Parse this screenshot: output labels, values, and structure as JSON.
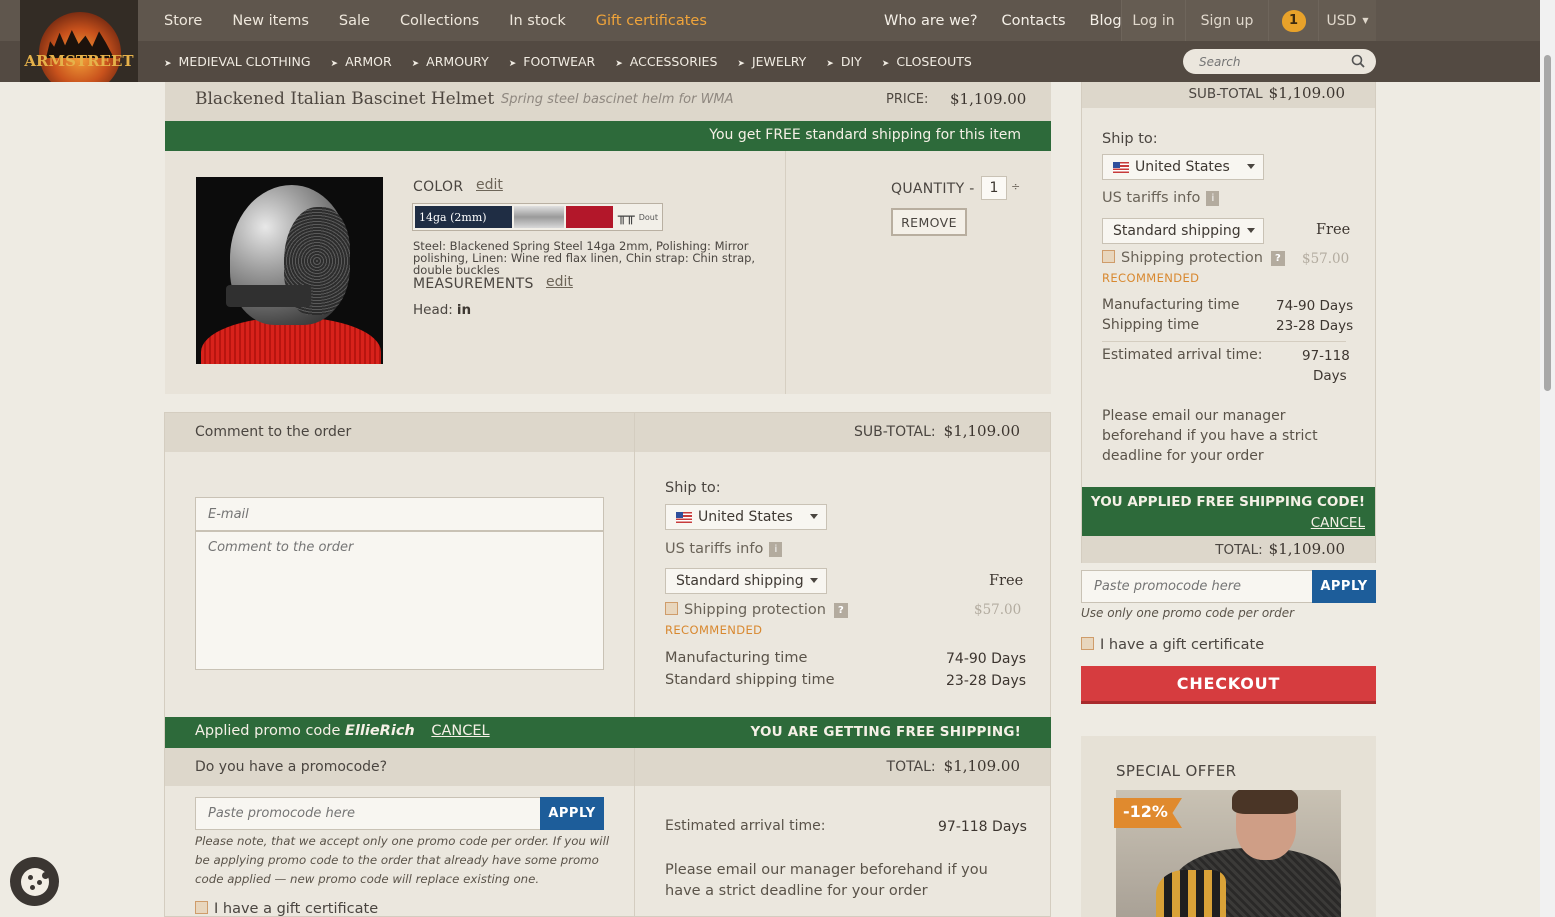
{
  "brand": {
    "logo_text": "ARMSTREET"
  },
  "topnav": {
    "items": [
      "Store",
      "New items",
      "Sale",
      "Collections",
      "In stock",
      "Gift certificates"
    ],
    "right": [
      "Who are we?",
      "Contacts",
      "Blog"
    ],
    "login": "Log in",
    "signup": "Sign up",
    "cart_count": "1",
    "currency": "USD"
  },
  "catnav": [
    "MEDIEVAL CLOTHING",
    "ARMOR",
    "ARMOURY",
    "FOOTWEAR",
    "ACCESSORIES",
    "JEWELRY",
    "DIY",
    "CLOSEOUTS"
  ],
  "search": {
    "placeholder": "Search"
  },
  "product": {
    "title": "Blackened Italian Bascinet Helmet",
    "subtitle": "Spring steel bascinet helm for WMA",
    "price_label": "PRICE:",
    "price": "$1,109.00",
    "free_shipping_note": "You get FREE standard shipping for this item",
    "color_label": "COLOR",
    "edit": "edit",
    "swatch_label": "14ga (2mm)",
    "swatch_extra": "Dout",
    "color_desc": "Steel: Blackened Spring Steel 14ga 2mm, Polishing: Mirror polishing, Linen: Wine red flax linen, Chin strap: Chin strap, double buckles",
    "measurements_label": "MEASUREMENTS",
    "head_label": "Head:",
    "head_value": "in",
    "quantity_label": "QUANTITY -",
    "quantity": "1",
    "remove": "REMOVE"
  },
  "order": {
    "comment_heading": "Comment to the order",
    "email_placeholder": "E-mail",
    "comment_placeholder": "Comment to the order",
    "subtotal_label": "SUB-TOTAL:",
    "subtotal": "$1,109.00",
    "ship_to": "Ship to:",
    "country": "United States",
    "tariffs": "US tariffs info",
    "info_mark": "i",
    "shipping_method": "Standard shipping",
    "shipping_cost": "Free",
    "protection": "Shipping protection",
    "protection_q": "?",
    "protection_price": "$57.00",
    "recommended": "RECOMMENDED",
    "mfg_label": "Manufacturing time",
    "mfg_value": "74-90 Days",
    "std_ship_label": "Standard shipping time",
    "std_ship_value": "23-28 Days",
    "promo_applied_prefix": "Applied promo code",
    "promo_code": "EllieRich",
    "cancel": "CANCEL",
    "free_shipping_banner": "YOU ARE GETTING FREE SHIPPING!",
    "have_promo": "Do you have a promocode?",
    "total_label": "TOTAL:",
    "total": "$1,109.00",
    "promo_placeholder": "Paste promocode here",
    "apply": "APPLY",
    "promo_note": "Please note, that we accept only one promo code per order. If you will be applying promo code to the order that already have some promo code applied — new promo code will replace existing one.",
    "gift_cert": "I have a gift certificate",
    "eta_label": "Estimated arrival time:",
    "eta_value": "97-118 Days",
    "deadline_note": "Please email our manager beforehand if you have a strict deadline for your order"
  },
  "sidebar": {
    "subtotal_label": "SUB-TOTAL",
    "subtotal": "$1,109.00",
    "ship_to": "Ship to:",
    "country": "United States",
    "tariffs": "US tariffs info",
    "shipping_method": "Standard shipping",
    "shipping_cost": "Free",
    "protection": "Shipping protection",
    "protection_price": "$57.00",
    "recommended": "RECOMMENDED",
    "mfg_label": "Manufacturing time",
    "mfg_value": "74-90 Days",
    "ship_label": "Shipping time",
    "ship_value": "23-28 Days",
    "eta_label": "Estimated arrival time:",
    "eta_value_1": "97-118",
    "eta_value_2": "Days",
    "deadline_note": "Please email our manager beforehand if you have a strict deadline for your order",
    "applied_code": "YOU APPLIED FREE SHIPPING CODE!",
    "cancel": "CANCEL",
    "total_label": "TOTAL:",
    "total": "$1,109.00",
    "promo_placeholder": "Paste promocode here",
    "apply": "APPLY",
    "promo_note": "Use only one promo code per order",
    "gift_cert": "I have a gift certificate",
    "checkout": "CHECKOUT",
    "special_offer": "SPECIAL OFFER",
    "discount": "-12%"
  },
  "colors": {
    "green": "#2d6a3a",
    "checkout": "#d63c3f",
    "apply": "#1d5d9a",
    "gift_link": "#f0a43a"
  }
}
